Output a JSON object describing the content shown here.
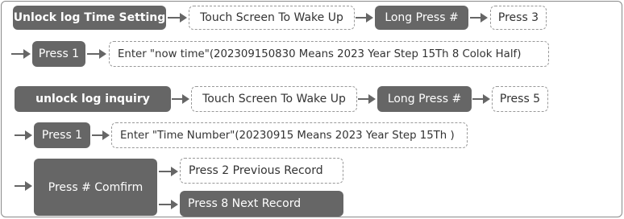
{
  "section1": {
    "title": "Unlock log Time Setting",
    "step_wake": "Touch Screen To Wake Up",
    "step_long_press": "Long Press #",
    "step_press3": "Press 3",
    "step_press1": "Press 1",
    "step_enter": "Enter \"now time\"(202309150830 Means 2023 Year Step 15Th 8 Colok Half)"
  },
  "section2": {
    "title": "unlock log inquiry",
    "step_wake": "Touch Screen To Wake Up",
    "step_long_press": "Long Press #",
    "step_press5": "Press 5",
    "step_press1": "Press 1",
    "step_enter": "Enter \"Time Number\"(20230915 Means 2023 Year Step 15Th )",
    "step_confirm": "Press # Comfirm",
    "step_prev": "Press 2  Previous Record",
    "step_next": "Press 8  Next Record"
  }
}
